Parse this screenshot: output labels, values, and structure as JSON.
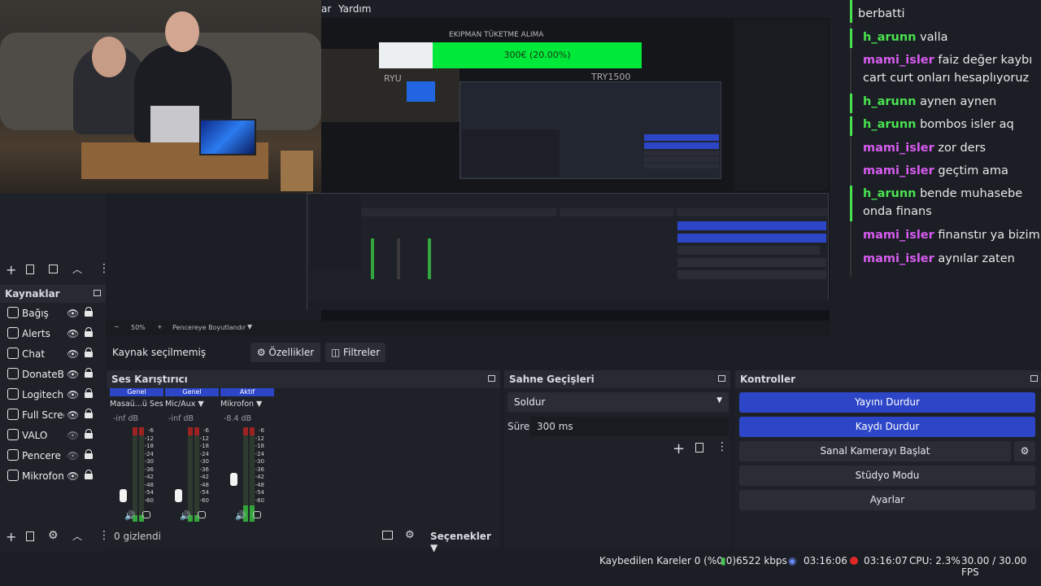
{
  "menu": {
    "items": [
      "ar",
      "Yardım"
    ]
  },
  "preview": {
    "overlay_title": "EKIPMAN TÜKETME ALIMA",
    "progress_label": "300€ (20.00%)",
    "progress_fraction": 0.2,
    "nested_label_left": "RYU",
    "nested_label_right": "TRY1500"
  },
  "chat": {
    "messages": [
      {
        "user": "",
        "text": "berbatti",
        "color": "none"
      },
      {
        "user": "h_arunn",
        "text": "valla",
        "color": "green"
      },
      {
        "user": "mami_isler",
        "text": "faiz değer kaybı cart curt onları hesaplıyoruz",
        "color": "purple"
      },
      {
        "user": "h_arunn",
        "text": "aynen aynen",
        "color": "green"
      },
      {
        "user": "h_arunn",
        "text": "bombos isler aq",
        "color": "green"
      },
      {
        "user": "mami_isler",
        "text": "zor ders",
        "color": "purple"
      },
      {
        "user": "mami_isler",
        "text": "geçtim ama",
        "color": "purple"
      },
      {
        "user": "h_arunn",
        "text": "bende muhasebe onda finans",
        "color": "green"
      },
      {
        "user": "mami_isler",
        "text": "finanstır ya bizim",
        "color": "purple"
      },
      {
        "user": "mami_isler",
        "text": "aynılar zaten",
        "color": "purple"
      }
    ]
  },
  "sources": {
    "title": "Kaynaklar",
    "items": [
      {
        "label": "Bağış",
        "visible": true
      },
      {
        "label": "Alerts",
        "visible": true
      },
      {
        "label": "Chat",
        "visible": true
      },
      {
        "label": "DonateBa",
        "visible": true
      },
      {
        "label": "Logitech",
        "visible": true
      },
      {
        "label": "Full Screen",
        "visible": true
      },
      {
        "label": "VALO",
        "visible": false
      },
      {
        "label": "Pencere Y",
        "visible": false
      },
      {
        "label": "Mikrofon",
        "visible": true
      }
    ]
  },
  "zoom": {
    "value": "50%",
    "fit_label": "Pencereye Boyutlandır"
  },
  "props": {
    "no_source": "Kaynak seçilmemiş",
    "properties": "Özellikler",
    "filters": "Filtreler"
  },
  "mixer": {
    "title": "Ses Karıştırıcı",
    "channels": [
      {
        "tag": "Genel",
        "name": "Masaü...ü Ses",
        "db": "-inf dB",
        "level": 0.0
      },
      {
        "tag": "Genel",
        "name": "Mic/Aux",
        "db": "-inf dB",
        "level": 0.0
      },
      {
        "tag": "Aktif",
        "name": "Mikrofon",
        "db": "-8.4 dB",
        "level": 0.25
      }
    ],
    "ticks": [
      "-6",
      "-12",
      "-18",
      "-24",
      "-30",
      "-36",
      "-42",
      "-48",
      "-54",
      "-60"
    ],
    "hidden": "0 gizlendi",
    "options": "Seçenekler"
  },
  "transitions": {
    "title": "Sahne Geçişleri",
    "selected": "Soldur",
    "duration_label": "Süre",
    "duration": "300 ms"
  },
  "controls": {
    "title": "Kontroller",
    "stop_stream": "Yayını Durdur",
    "stop_record": "Kaydı Durdur",
    "virtual_cam": "Sanal Kamerayı Başlat",
    "studio": "Stüdyo Modu",
    "settings": "Ayarlar"
  },
  "statusbar": {
    "dropped": "Kaybedilen Kareler 0 (%0.0)",
    "bitrate": "6522 kbps",
    "stream_time": "03:16:06",
    "rec_time": "03:16:07",
    "cpu": "CPU: 2.3%",
    "fps": "30.00 / 30.00 FPS"
  },
  "colors": {
    "accent": "#2d46c8",
    "green_user": "#49e24f",
    "purple_user": "#d75cf0",
    "progress": "#00e83a"
  }
}
